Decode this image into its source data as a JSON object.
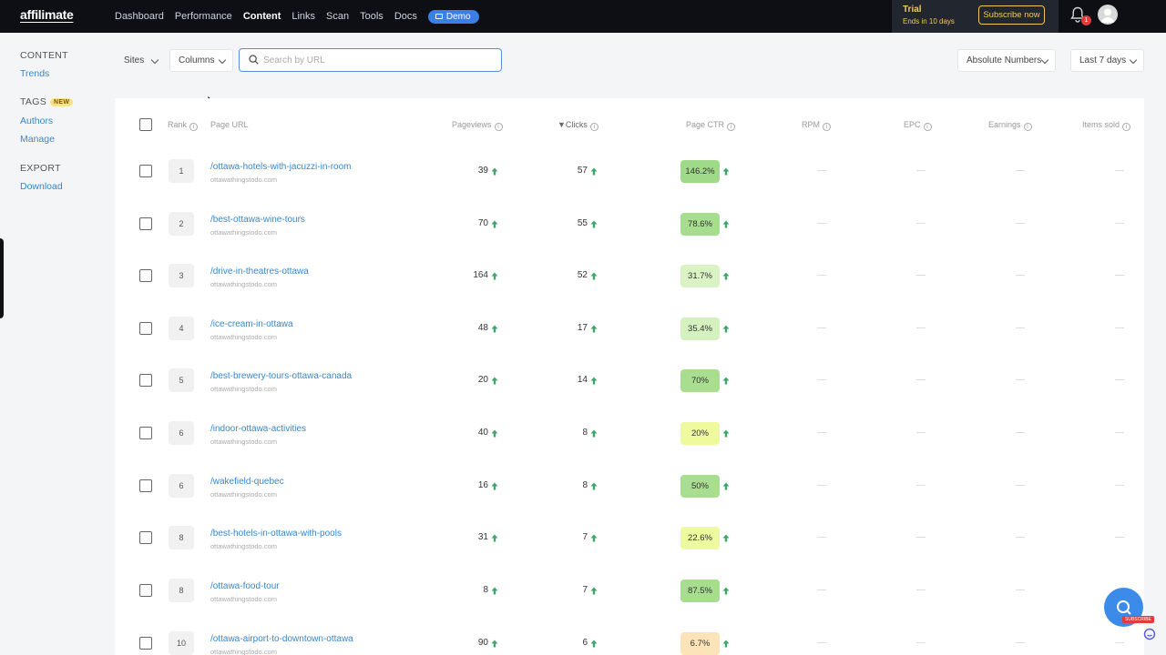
{
  "topbar": {
    "logo": "affilimate",
    "nav": [
      "Dashboard",
      "Performance",
      "Content",
      "Links",
      "Scan",
      "Tools",
      "Docs"
    ],
    "active": "Content",
    "demo_label": "Demo",
    "trial_title": "Trial",
    "trial_sub": "Ends in 10 days",
    "subscribe_label": "Subscribe now",
    "notification_count": "1"
  },
  "sidebar": {
    "content_heading": "CONTENT",
    "trends": "Trends",
    "tags_heading": "TAGS",
    "new_badge": "NEW",
    "authors": "Authors",
    "manage": "Manage",
    "export_heading": "EXPORT",
    "download": "Download"
  },
  "filters": {
    "sites": "Sites",
    "columns": "Columns",
    "search_placeholder": "Search by URL",
    "numbers_mode": "Absolute Numbers",
    "date_range": "Last 7 days"
  },
  "table": {
    "headers": {
      "rank": "Rank",
      "page_url": "Page URL",
      "pageviews": "Pageviews",
      "clicks": "Clicks",
      "page_ctr": "Page CTR",
      "rpm": "RPM",
      "epc": "EPC",
      "earnings": "Earnings",
      "items_sold": "Items sold"
    },
    "sort_indicator": "▼",
    "empty_value": "—",
    "rows": [
      {
        "rank": "1",
        "url": "/ottawa-hotels-with-jacuzzi-in-room",
        "domain": "ottawathingstodo.com",
        "pageviews": "39",
        "clicks": "57",
        "ctr": "146.2%",
        "ctr_color": "#9fd98a"
      },
      {
        "rank": "2",
        "url": "/best-ottawa-wine-tours",
        "domain": "ottawathingstodo.com",
        "pageviews": "70",
        "clicks": "55",
        "ctr": "78.6%",
        "ctr_color": "#a6dd8e"
      },
      {
        "rank": "3",
        "url": "/drive-in-theatres-ottawa",
        "domain": "ottawathingstodo.com",
        "pageviews": "164",
        "clicks": "52",
        "ctr": "31.7%",
        "ctr_color": "#daf3c4"
      },
      {
        "rank": "4",
        "url": "/ice-cream-in-ottawa",
        "domain": "ottawathingstodo.com",
        "pageviews": "48",
        "clicks": "17",
        "ctr": "35.4%",
        "ctr_color": "#d6f1c0"
      },
      {
        "rank": "5",
        "url": "/best-brewery-tours-ottawa-canada",
        "domain": "ottawathingstodo.com",
        "pageviews": "20",
        "clicks": "14",
        "ctr": "70%",
        "ctr_color": "#a9de91"
      },
      {
        "rank": "6",
        "url": "/indoor-ottawa-activities",
        "domain": "ottawathingstodo.com",
        "pageviews": "40",
        "clicks": "8",
        "ctr": "20%",
        "ctr_color": "#effa9e"
      },
      {
        "rank": "6",
        "url": "/wakefield-quebec",
        "domain": "ottawathingstodo.com",
        "pageviews": "16",
        "clicks": "8",
        "ctr": "50%",
        "ctr_color": "#a9de91"
      },
      {
        "rank": "8",
        "url": "/best-hotels-in-ottawa-with-pools",
        "domain": "ottawathingstodo.com",
        "pageviews": "31",
        "clicks": "7",
        "ctr": "22.6%",
        "ctr_color": "#eefa9e"
      },
      {
        "rank": "8",
        "url": "/ottawa-food-tour",
        "domain": "ottawathingstodo.com",
        "pageviews": "8",
        "clicks": "7",
        "ctr": "87.5%",
        "ctr_color": "#a6dd8e"
      },
      {
        "rank": "10",
        "url": "/ottawa-airport-to-downtown-ottawa",
        "domain": "ottawathingstodo.com",
        "pageviews": "90",
        "clicks": "6",
        "ctr": "6.7%",
        "ctr_color": "#fde4b8"
      }
    ]
  },
  "help": {
    "subscribe_badge": "SUBSCRIBE"
  }
}
